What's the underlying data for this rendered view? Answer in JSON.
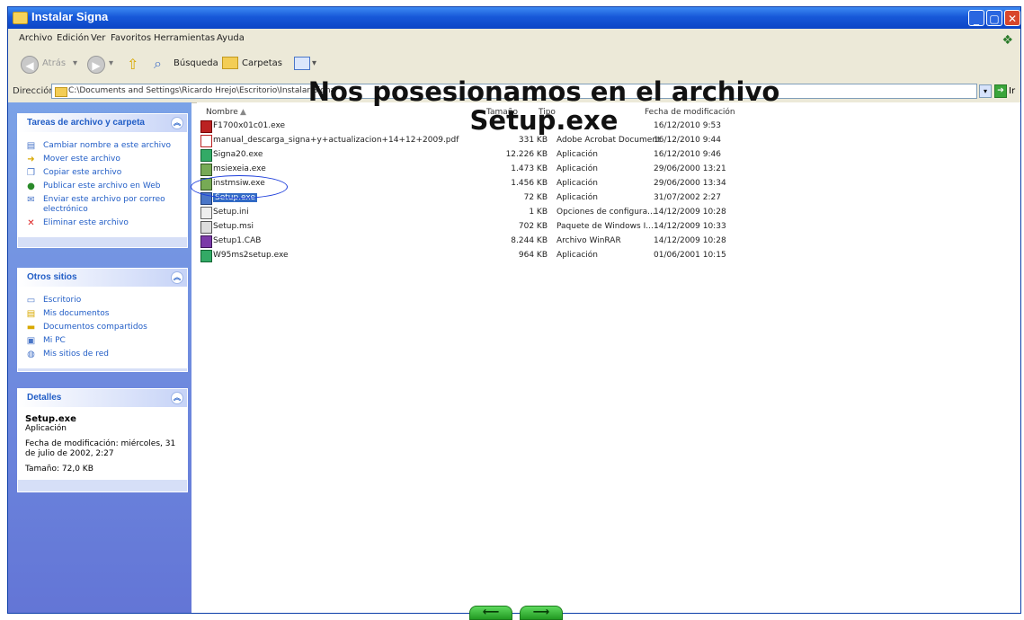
{
  "window": {
    "title": "Instalar Signa"
  },
  "menu": [
    "Archivo",
    "Edición",
    "Ver",
    "Favoritos",
    "Herramientas",
    "Ayuda"
  ],
  "toolbar": {
    "back": "Atrás",
    "search": "Búsqueda",
    "folders": "Carpetas"
  },
  "address": {
    "label": "Dirección",
    "path": "C:\\Documents and Settings\\Ricardo Hrejo\\Escritorio\\Instalar Signa",
    "go": "Ir"
  },
  "overlay": {
    "line1": "Nos posesionamos en el archivo",
    "line2": "Setup.exe"
  },
  "panels": {
    "tasks": {
      "title": "Tareas de archivo y carpeta",
      "items": [
        "Cambiar nombre a este archivo",
        "Mover este archivo",
        "Copiar este archivo",
        "Publicar este archivo en Web",
        "Enviar este archivo por correo electrónico",
        "Eliminar este archivo"
      ]
    },
    "places": {
      "title": "Otros sitios",
      "items": [
        "Escritorio",
        "Mis documentos",
        "Documentos compartidos",
        "Mi PC",
        "Mis sitios de red"
      ]
    },
    "details": {
      "title": "Detalles",
      "name": "Setup.exe",
      "type": "Aplicación",
      "modified": "Fecha de modificación: miércoles, 31 de julio de 2002, 2:27",
      "size": "Tamaño: 72,0 KB"
    }
  },
  "columns": {
    "name": "Nombre",
    "size": "Tamaño",
    "type": "Tipo",
    "date": "Fecha de modificación"
  },
  "files": [
    {
      "name": "F1700x01c01.exe",
      "size": "",
      "type": "",
      "date": "16/12/2010 9:53"
    },
    {
      "name": "manual_descarga_signa+y+actualizacion+14+12+2009.pdf",
      "size": "331 KB",
      "type": "Adobe Acrobat Document",
      "date": "16/12/2010 9:44"
    },
    {
      "name": "Signa20.exe",
      "size": "12.226 KB",
      "type": "Aplicación",
      "date": "16/12/2010 9:46"
    },
    {
      "name": "msiexeia.exe",
      "size": "1.473 KB",
      "type": "Aplicación",
      "date": "29/06/2000 13:21"
    },
    {
      "name": "instmsiw.exe",
      "size": "1.456 KB",
      "type": "Aplicación",
      "date": "29/06/2000 13:34"
    },
    {
      "name": "Setup.exe",
      "size": "72 KB",
      "type": "Aplicación",
      "date": "31/07/2002 2:27"
    },
    {
      "name": "Setup.ini",
      "size": "1 KB",
      "type": "Opciones de configura...",
      "date": "14/12/2009 10:28"
    },
    {
      "name": "Setup.msi",
      "size": "702 KB",
      "type": "Paquete de Windows I...",
      "date": "14/12/2009 10:33"
    },
    {
      "name": "Setup1.CAB",
      "size": "8.244 KB",
      "type": "Archivo WinRAR",
      "date": "14/12/2009 10:28"
    },
    {
      "name": "W95ms2setup.exe",
      "size": "964 KB",
      "type": "Aplicación",
      "date": "01/06/2001 10:15"
    }
  ],
  "nav": {
    "prev": "⟵",
    "next": "⟶"
  }
}
